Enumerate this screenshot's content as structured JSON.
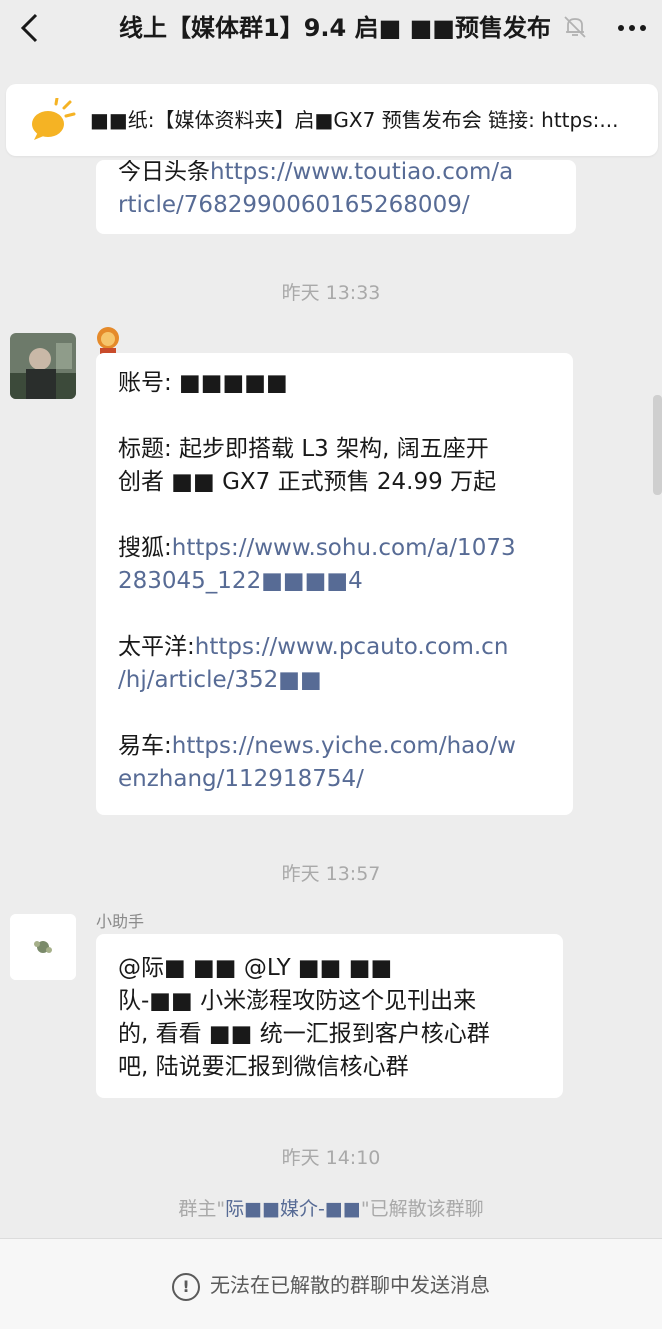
{
  "header": {
    "title": "线上【媒体群1】9.4 启■ ■■预售发布",
    "back_icon": "chevron-left-icon",
    "mute_icon": "bell-off-icon",
    "more_icon": "more-dots-icon"
  },
  "pinned": {
    "icon": "announcement-bulb-icon",
    "text": "■■纸:【媒体资料夹】启■GX7 预售发布会 链接: https:..."
  },
  "messages": {
    "m0": {
      "line1_prefix": "今日头条",
      "line1_link": "https://www.toutiao.com/a",
      "line2_link": "rticle/7682990060165268009/"
    },
    "time1": "昨天 13:33",
    "m1": {
      "line1": "账号: ■■■■■",
      "title_line1": "标题: 起步即搭载 L3 架构, 阔五座开",
      "title_line2": "创者 ■■ GX7 正式预售 24.99 万起",
      "sohu_label": "搜狐:",
      "sohu_link1": "https://www.sohu.com/a/1073",
      "sohu_link2": "283045_122■■■■4",
      "pcauto_label": "太平洋:",
      "pcauto_link1": "https://www.pcauto.com.cn",
      "pcauto_link2": "/hj/article/352■■",
      "yiche_label": "易车:",
      "yiche_link1": "https://news.yiche.com/hao/w",
      "yiche_link2": "enzhang/112918754/"
    },
    "time2": "昨天 13:57",
    "m2": {
      "sender": "小助手",
      "line1": "@际■ ■■ @LY ■■ ■■",
      "line2": "队-■■ 小米澎程攻防这个见刊出来",
      "line3": "的, 看看 ■■ 统一汇报到客户核心群",
      "line4": "吧, 陆说要汇报到微信核心群"
    },
    "time3": "昨天 14:10",
    "system": {
      "prefix": "群主\"",
      "name": "际■■媒介-■■",
      "suffix": "\"已解散该群聊"
    }
  },
  "bottom": {
    "notice": "无法在已解散的群聊中发送消息",
    "icon": "warning-circle-icon"
  }
}
